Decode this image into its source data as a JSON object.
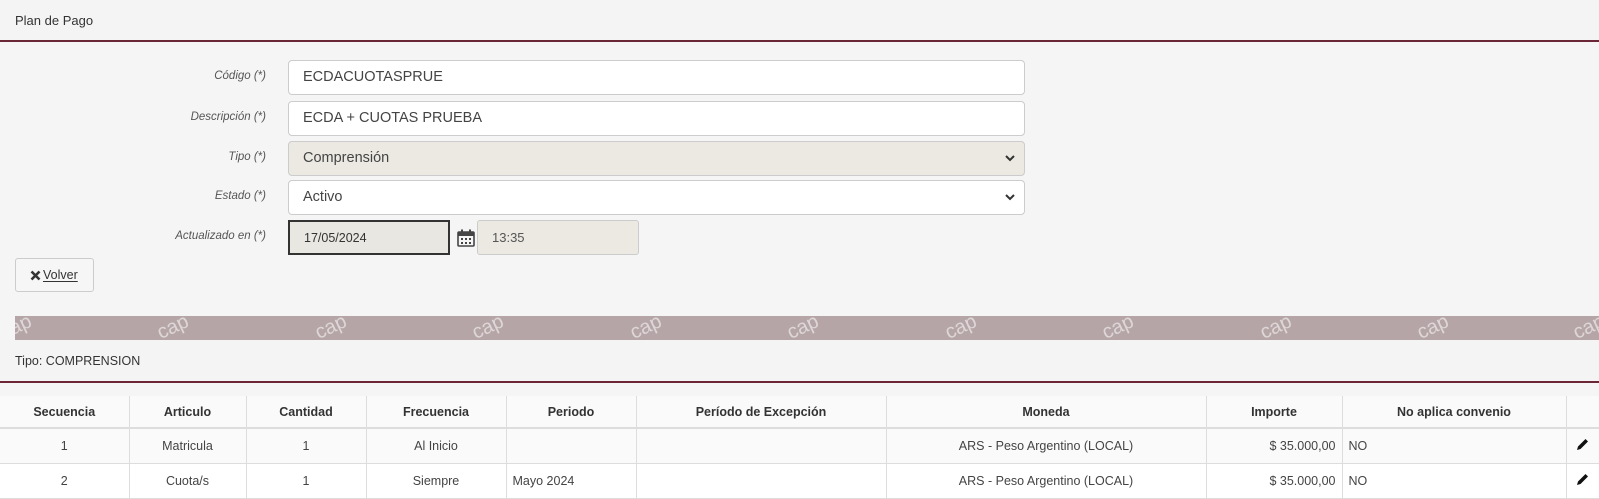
{
  "panel": {
    "title": "Plan de Pago"
  },
  "form": {
    "codigo": {
      "label": "Código (*)",
      "value": "ECDACUOTASPRUE"
    },
    "descripcion": {
      "label": "Descripción (*)",
      "value": "ECDA + CUOTAS PRUEBA"
    },
    "tipo": {
      "label": "Tipo (*)",
      "value": "Comprensión"
    },
    "estado": {
      "label": "Estado (*)",
      "value": "Activo"
    },
    "actualizado": {
      "label": "Actualizado en (*)",
      "date": "17/05/2024",
      "time": "13:35"
    }
  },
  "volver_button": {
    "label": "Volver"
  },
  "watermark": "cap",
  "section": {
    "title": "Tipo: COMPRENSION"
  },
  "table": {
    "headers": [
      "Secuencia",
      "Articulo",
      "Cantidad",
      "Frecuencia",
      "Periodo",
      "Período de Excepción",
      "Moneda",
      "Importe",
      "No aplica convenio",
      ""
    ],
    "rows": [
      [
        "1",
        "Matricula",
        "1",
        "Al Inicio",
        "",
        "",
        "ARS - Peso Argentino (LOCAL)",
        "$ 35.000,00",
        "NO",
        ""
      ],
      [
        "2",
        "Cuota/s",
        "1",
        "Siempre",
        "Mayo 2024",
        "",
        "ARS - Peso Argentino (LOCAL)",
        "$ 35.000,00",
        "NO",
        ""
      ]
    ]
  },
  "icons": {
    "calendar": "calendar-icon",
    "close": "close-icon",
    "edit": "pencil-icon",
    "dropdown": "chevron-down-icon"
  },
  "colors": {
    "accent": "#6b2736",
    "band": "#b5a5a7"
  }
}
